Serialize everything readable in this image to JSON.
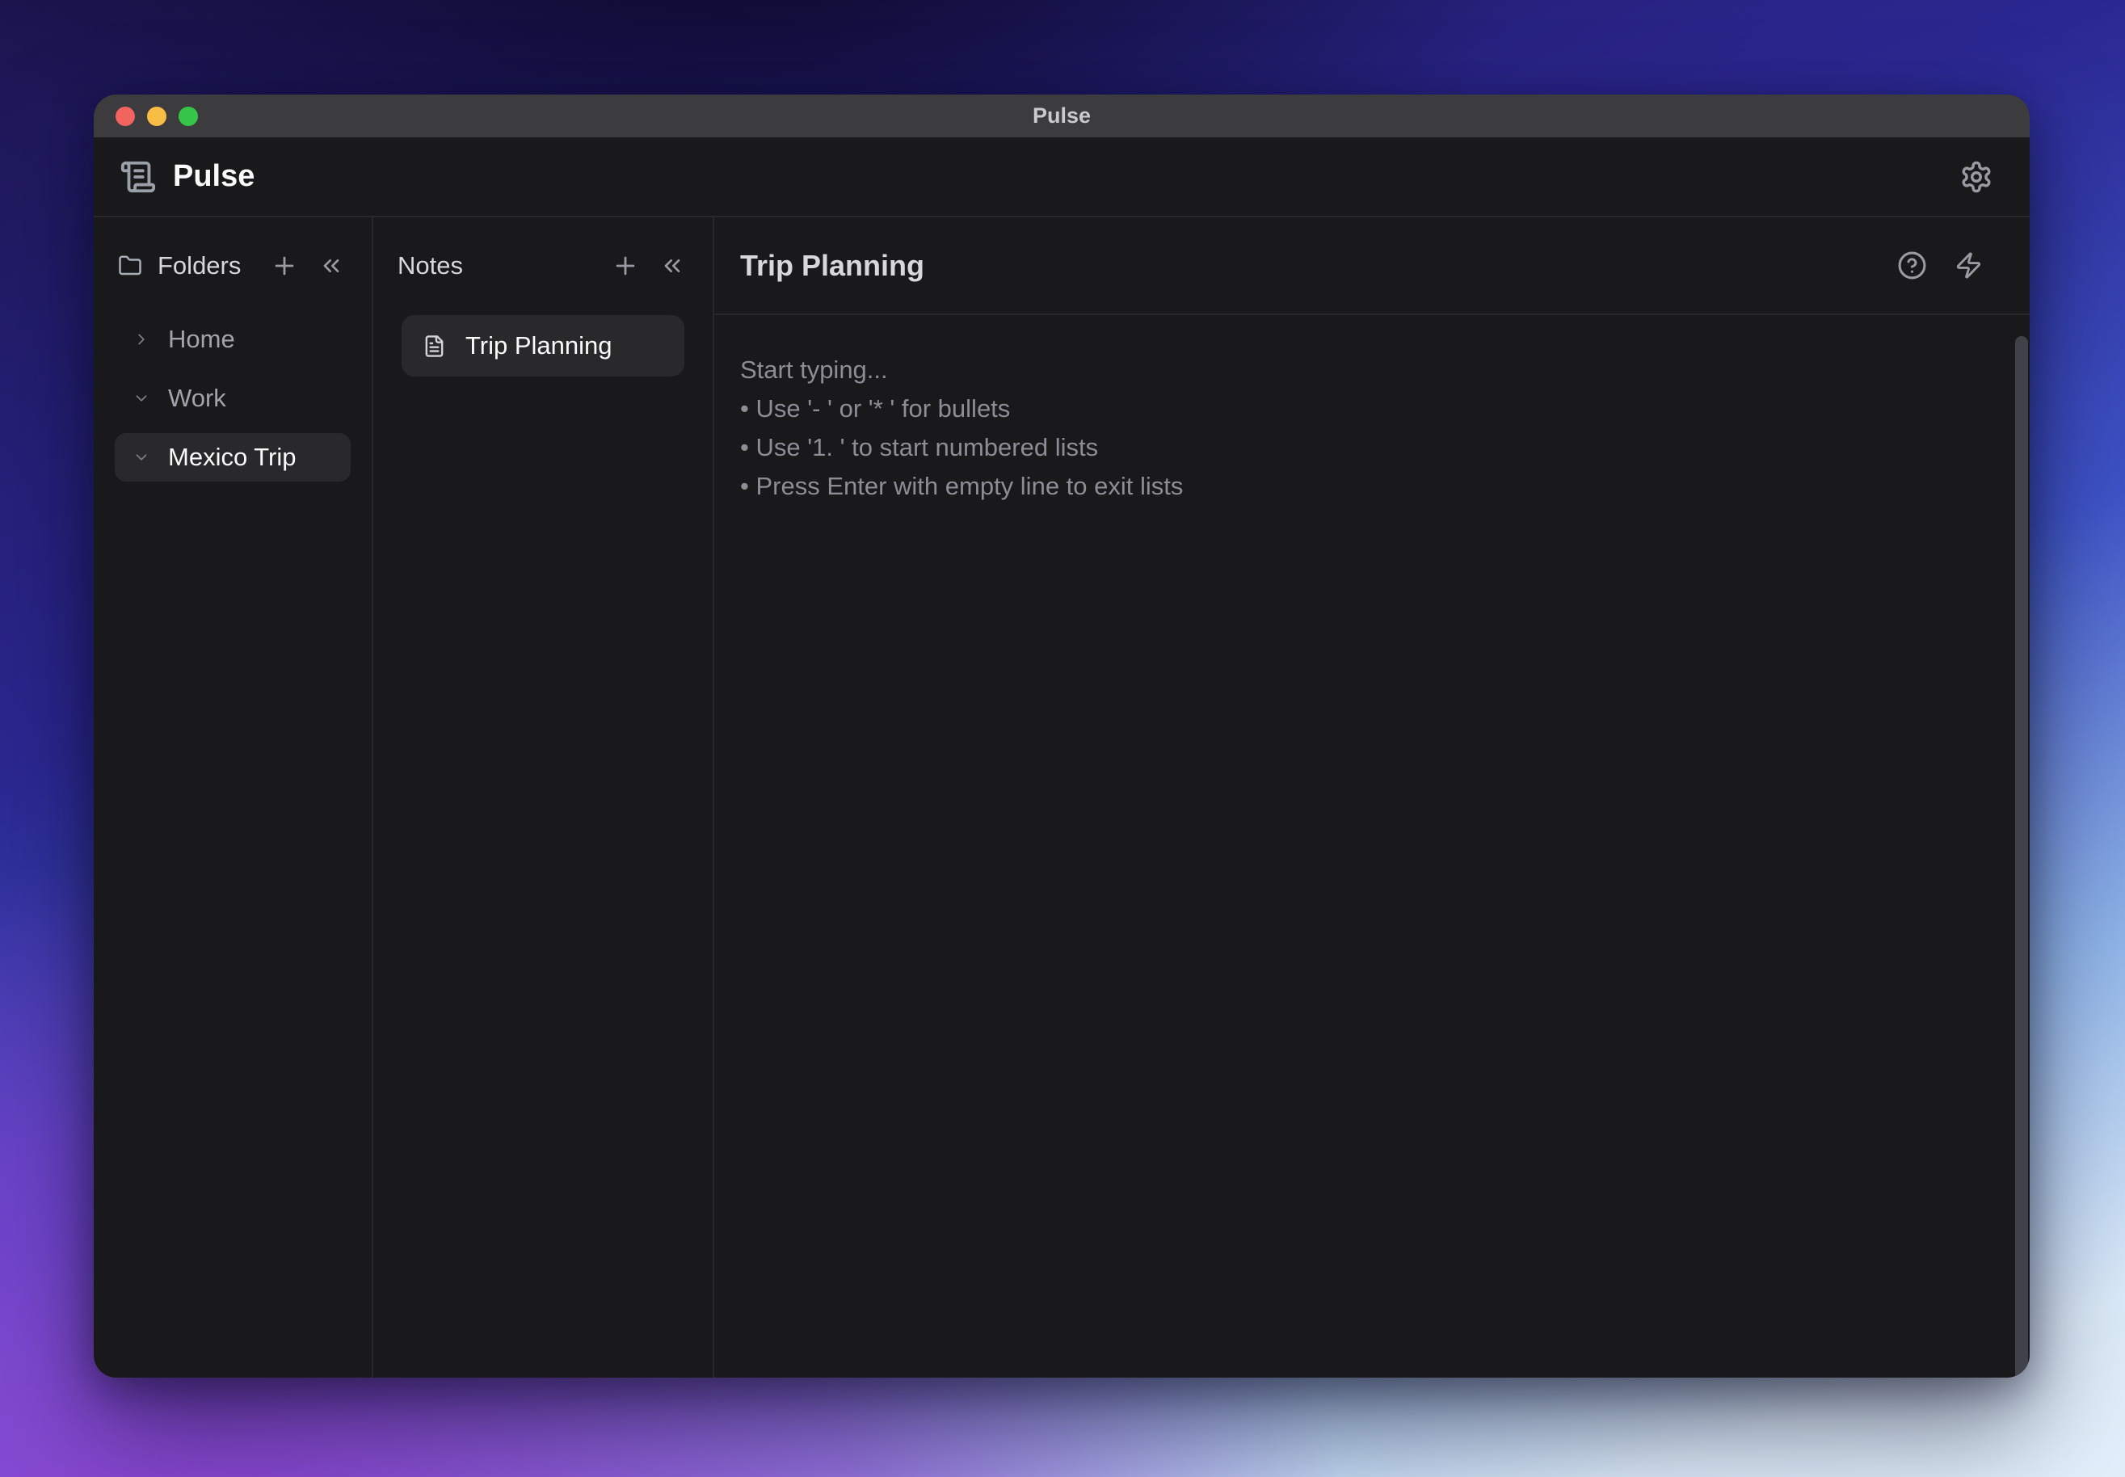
{
  "window": {
    "titlebar": {
      "title": "Pulse"
    }
  },
  "app_header": {
    "app_name": "Pulse"
  },
  "folders_panel": {
    "title": "Folders",
    "items": [
      {
        "label": "Home",
        "chevron": "right",
        "selected": false
      },
      {
        "label": "Work",
        "chevron": "down",
        "selected": false
      },
      {
        "label": "Mexico Trip",
        "chevron": "down",
        "selected": true
      }
    ]
  },
  "notes_panel": {
    "title": "Notes",
    "items": [
      {
        "label": "Trip Planning",
        "selected": true
      }
    ]
  },
  "content": {
    "title": "Trip Planning",
    "editor_lines": [
      "Start typing...",
      "• Use '- ' or '* ' for bullets",
      "• Use '1. ' to start numbered lists",
      "• Press Enter with empty line to exit lists"
    ]
  },
  "icons": {
    "logo": "scroll-text-icon",
    "settings": "gear-icon",
    "folders_header": "folder-icon",
    "add": "plus-icon",
    "collapse": "chevrons-left-icon",
    "note": "file-text-icon",
    "help": "help-circle-icon",
    "quick_actions": "zap-icon"
  },
  "colors": {
    "window_bg": "#19191b",
    "titlebar_bg": "#3c3c3e",
    "selected_item_bg": "#29292c",
    "divider": "#29292c",
    "traffic_red": "#f4645f",
    "traffic_yellow": "#f7bd45",
    "traffic_green": "#35c649",
    "bg_purple": "#8b3ed0",
    "bg_indigo": "#2b2791",
    "bg_lightblue": "#dcebf9"
  }
}
